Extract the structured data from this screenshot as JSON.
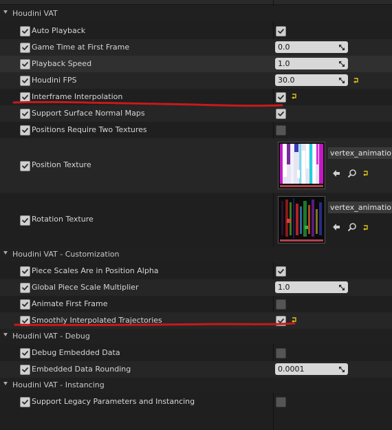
{
  "colors": {
    "annotation_line": "#c8191c",
    "texture_bar": "#b7404d",
    "panel_bg": "#1f1f1f"
  },
  "categories": {
    "vat": "Houdini VAT",
    "customization": "Houdini VAT - Customization",
    "debug": "Houdini VAT - Debug",
    "instancing": "Houdini VAT - Instancing"
  },
  "params": {
    "auto_playback": {
      "label": "Auto Playback",
      "enabled": true,
      "value_checked": true
    },
    "game_time": {
      "label": "Game Time at First Frame",
      "enabled": true,
      "value": "0.0"
    },
    "playback_speed": {
      "label": "Playback Speed",
      "enabled": true,
      "value": "1.0"
    },
    "houdini_fps": {
      "label": "Houdini FPS",
      "enabled": true,
      "value": "30.0",
      "reset_icon": "reset-arrow-icon"
    },
    "interframe": {
      "label": "Interframe Interpolation",
      "enabled": true,
      "value_checked": true,
      "reset_icon": "reset-arrow-icon"
    },
    "surface_normal": {
      "label": "Support Surface Normal Maps",
      "enabled": true,
      "value_checked": true
    },
    "two_textures": {
      "label": "Positions Require Two Textures",
      "enabled": true,
      "value_checked": false
    },
    "position_texture": {
      "label": "Position Texture",
      "enabled": true,
      "asset_name": "vertex_animation_"
    },
    "rotation_texture": {
      "label": "Rotation Texture",
      "enabled": true,
      "asset_name": "vertex_animation_"
    },
    "piece_scales": {
      "label": "Piece Scales Are in Position Alpha",
      "enabled": true,
      "value_checked": true
    },
    "global_piece_scale": {
      "label": "Global Piece Scale Multiplier",
      "enabled": true,
      "value": "1.0"
    },
    "animate_first": {
      "label": "Animate First Frame",
      "enabled": true,
      "value_checked": false
    },
    "smooth_traj": {
      "label": "Smoothly Interpolated Trajectories",
      "enabled": true,
      "value_checked": true,
      "reset_icon": "reset-arrow-icon"
    },
    "debug_embedded": {
      "label": "Debug Embedded Data",
      "enabled": true,
      "value_checked": false
    },
    "embedded_rounding": {
      "label": "Embedded Data Rounding",
      "enabled": true,
      "value": "0.0001"
    },
    "legacy": {
      "label": "Support Legacy Parameters and Instancing",
      "enabled": true,
      "value_checked": false
    }
  },
  "icons": {
    "checkmark": "checkmark-icon",
    "grip": "drag-grip-icon",
    "use_asset": "arrow-left-icon",
    "browse_asset": "search-icon",
    "reset": "reset-arrow-icon"
  }
}
